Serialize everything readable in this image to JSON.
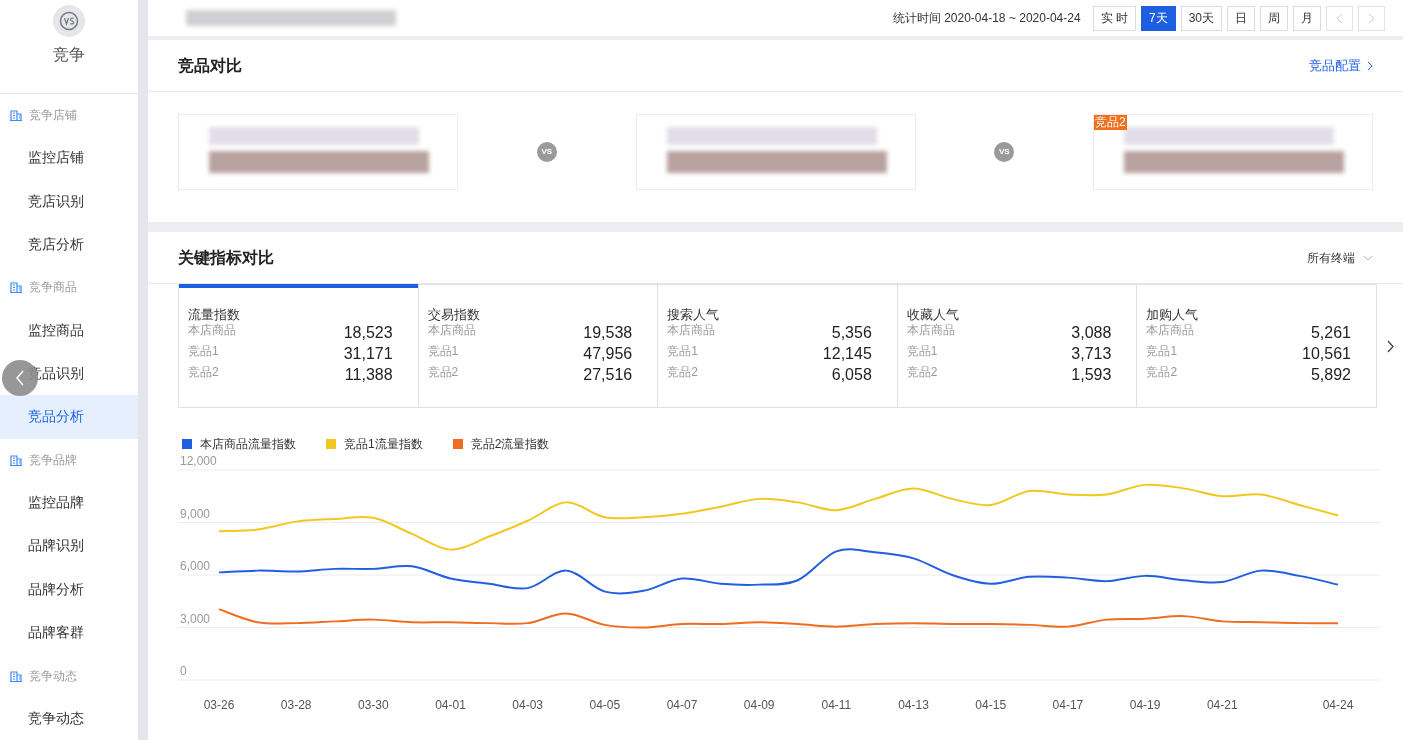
{
  "sidebar": {
    "title": "竞争",
    "groups": [
      {
        "label": "竞争店铺",
        "items": [
          {
            "label": "监控店铺",
            "selected": false
          },
          {
            "label": "竞店识别",
            "selected": false
          },
          {
            "label": "竞店分析",
            "selected": false
          }
        ]
      },
      {
        "label": "竞争商品",
        "items": [
          {
            "label": "监控商品",
            "selected": false
          },
          {
            "label": "竞品识别",
            "selected": false
          },
          {
            "label": "竞品分析",
            "selected": true
          }
        ]
      },
      {
        "label": "竞争品牌",
        "items": [
          {
            "label": "监控品牌",
            "selected": false
          },
          {
            "label": "品牌识别",
            "selected": false
          },
          {
            "label": "品牌分析",
            "selected": false
          },
          {
            "label": "品牌客群",
            "selected": false
          }
        ]
      },
      {
        "label": "竞争动态",
        "items": [
          {
            "label": "竞争动态",
            "selected": false
          }
        ]
      }
    ]
  },
  "header": {
    "date_range": "统计时间 2020-04-18 ~ 2020-04-24",
    "periods": [
      {
        "label": "实 时",
        "selected": false
      },
      {
        "label": "7天",
        "selected": true
      },
      {
        "label": "30天",
        "selected": false
      },
      {
        "label": "日",
        "selected": false
      },
      {
        "label": "周",
        "selected": false
      },
      {
        "label": "月",
        "selected": false
      }
    ]
  },
  "comparison": {
    "title": "竞品对比",
    "config_link": "竞品配置",
    "tiles": [
      {
        "kind": "product"
      },
      {
        "kind": "product"
      },
      {
        "kind": "product",
        "badge": "竞品2"
      }
    ],
    "vs_marks": [
      "VS",
      "VS"
    ]
  },
  "metrics": {
    "title": "关键指标对比",
    "terminal": "所有终端",
    "cards": [
      {
        "title": "流量指数",
        "selected": true,
        "rows": [
          {
            "label": "本店商品",
            "value": "18,523"
          },
          {
            "label": "竞品1",
            "value": "31,171"
          },
          {
            "label": "竞品2",
            "value": "11,388"
          }
        ]
      },
      {
        "title": "交易指数",
        "selected": false,
        "rows": [
          {
            "label": "本店商品",
            "value": "19,538"
          },
          {
            "label": "竞品1",
            "value": "47,956"
          },
          {
            "label": "竞品2",
            "value": "27,516"
          }
        ]
      },
      {
        "title": "搜索人气",
        "selected": false,
        "rows": [
          {
            "label": "本店商品",
            "value": "5,356"
          },
          {
            "label": "竞品1",
            "value": "12,145"
          },
          {
            "label": "竞品2",
            "value": "6,058"
          }
        ]
      },
      {
        "title": "收藏人气",
        "selected": false,
        "rows": [
          {
            "label": "本店商品",
            "value": "3,088"
          },
          {
            "label": "竞品1",
            "value": "3,713"
          },
          {
            "label": "竞品2",
            "value": "1,593"
          }
        ]
      },
      {
        "title": "加购人气",
        "selected": false,
        "rows": [
          {
            "label": "本店商品",
            "value": "5,261"
          },
          {
            "label": "竞品1",
            "value": "10,561"
          },
          {
            "label": "竞品2",
            "value": "5,892"
          }
        ]
      }
    ],
    "chart_data": {
      "type": "line",
      "categories": [
        "03-26",
        null,
        "03-28",
        null,
        "03-30",
        null,
        "04-01",
        null,
        "04-03",
        null,
        "04-05",
        null,
        "04-07",
        null,
        "04-09",
        null,
        "04-11",
        null,
        "04-13",
        null,
        "04-15",
        null,
        "04-17",
        null,
        "04-19",
        null,
        "04-21",
        null,
        null,
        "04-24"
      ],
      "grid": true,
      "legend": "top-left",
      "series": [
        {
          "name": "本店商品流量指数",
          "color": "#2060e0",
          "values": [
            6150,
            6250,
            6200,
            6350,
            6350,
            6500,
            5800,
            5500,
            5250,
            6250,
            5050,
            5100,
            5800,
            5500,
            5450,
            5700,
            7350,
            7300,
            6950,
            6000,
            5500,
            5900,
            5850,
            5650,
            5950,
            5700,
            5600,
            6250,
            5950,
            5450
          ]
        },
        {
          "name": "竞品1流量指数",
          "color": "#f0c820",
          "values": [
            8500,
            8600,
            9050,
            9200,
            9270,
            8350,
            7450,
            8200,
            9100,
            10150,
            9300,
            9300,
            9500,
            9900,
            10350,
            10150,
            9700,
            10350,
            10950,
            10350,
            10000,
            10800,
            10600,
            10600,
            11150,
            10950,
            10500,
            10600,
            10000,
            9400
          ]
        },
        {
          "name": "竞品2流量指数",
          "color": "#f06c20",
          "values": [
            4050,
            3300,
            3250,
            3350,
            3450,
            3300,
            3300,
            3250,
            3250,
            3800,
            3150,
            3000,
            3200,
            3200,
            3300,
            3200,
            3050,
            3200,
            3250,
            3200,
            3200,
            3150,
            3050,
            3450,
            3500,
            3650,
            3350,
            3300,
            3250,
            3250
          ]
        }
      ],
      "ylim": [
        0,
        12000
      ],
      "yticks": [
        {
          "value": 0,
          "label": "0"
        },
        {
          "value": 3000,
          "label": "3,000"
        },
        {
          "value": 6000,
          "label": "6,000"
        },
        {
          "value": 9000,
          "label": "9,000"
        },
        {
          "value": 12000,
          "label": "12,000"
        }
      ]
    }
  }
}
